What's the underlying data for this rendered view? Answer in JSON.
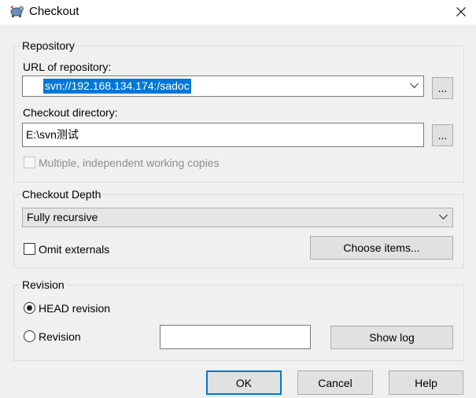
{
  "window": {
    "title": "Checkout",
    "icons": {
      "app": "svn-turtle-icon",
      "close": "close-icon"
    }
  },
  "repository": {
    "group_label": "Repository",
    "url_label": "URL of repository:",
    "url_value": "svn://192.168.134.174:/sadoc",
    "browse_label": "...",
    "dir_label": "Checkout directory:",
    "dir_value": "E:\\svn测试",
    "dir_browse_label": "...",
    "multiple_label": "Multiple, independent working copies"
  },
  "depth": {
    "group_label": "Checkout Depth",
    "selected": "Fully recursive",
    "omit_externals_label": "Omit externals",
    "choose_items_label": "Choose items..."
  },
  "revision": {
    "group_label": "Revision",
    "head_label": "HEAD revision",
    "revision_label": "Revision",
    "revision_value": "",
    "show_log_label": "Show log"
  },
  "footer": {
    "ok": "OK",
    "cancel": "Cancel",
    "help": "Help"
  }
}
